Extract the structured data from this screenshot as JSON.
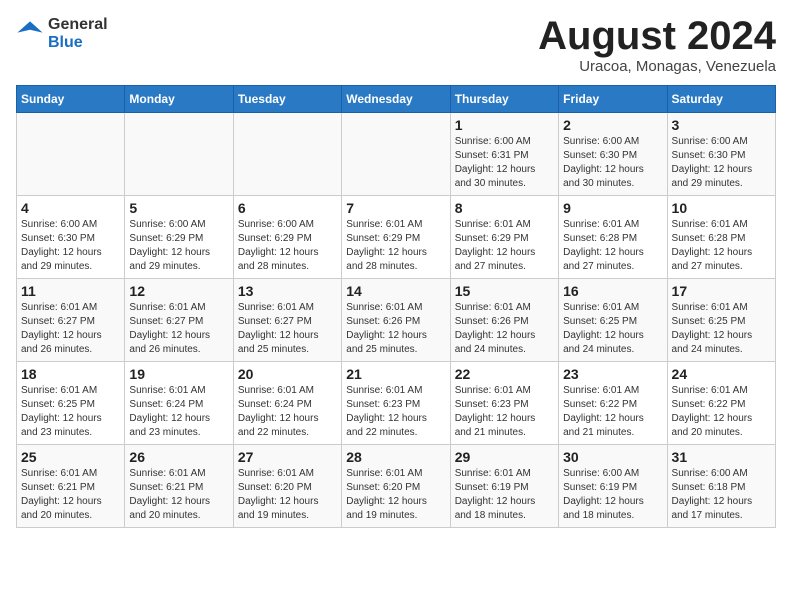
{
  "header": {
    "logo_general": "General",
    "logo_blue": "Blue",
    "month_title": "August 2024",
    "location": "Uracoa, Monagas, Venezuela"
  },
  "days_of_week": [
    "Sunday",
    "Monday",
    "Tuesday",
    "Wednesday",
    "Thursday",
    "Friday",
    "Saturday"
  ],
  "weeks": [
    [
      {
        "day": "",
        "info": ""
      },
      {
        "day": "",
        "info": ""
      },
      {
        "day": "",
        "info": ""
      },
      {
        "day": "",
        "info": ""
      },
      {
        "day": "1",
        "info": "Sunrise: 6:00 AM\nSunset: 6:31 PM\nDaylight: 12 hours\nand 30 minutes."
      },
      {
        "day": "2",
        "info": "Sunrise: 6:00 AM\nSunset: 6:30 PM\nDaylight: 12 hours\nand 30 minutes."
      },
      {
        "day": "3",
        "info": "Sunrise: 6:00 AM\nSunset: 6:30 PM\nDaylight: 12 hours\nand 29 minutes."
      }
    ],
    [
      {
        "day": "4",
        "info": "Sunrise: 6:00 AM\nSunset: 6:30 PM\nDaylight: 12 hours\nand 29 minutes."
      },
      {
        "day": "5",
        "info": "Sunrise: 6:00 AM\nSunset: 6:29 PM\nDaylight: 12 hours\nand 29 minutes."
      },
      {
        "day": "6",
        "info": "Sunrise: 6:00 AM\nSunset: 6:29 PM\nDaylight: 12 hours\nand 28 minutes."
      },
      {
        "day": "7",
        "info": "Sunrise: 6:01 AM\nSunset: 6:29 PM\nDaylight: 12 hours\nand 28 minutes."
      },
      {
        "day": "8",
        "info": "Sunrise: 6:01 AM\nSunset: 6:29 PM\nDaylight: 12 hours\nand 27 minutes."
      },
      {
        "day": "9",
        "info": "Sunrise: 6:01 AM\nSunset: 6:28 PM\nDaylight: 12 hours\nand 27 minutes."
      },
      {
        "day": "10",
        "info": "Sunrise: 6:01 AM\nSunset: 6:28 PM\nDaylight: 12 hours\nand 27 minutes."
      }
    ],
    [
      {
        "day": "11",
        "info": "Sunrise: 6:01 AM\nSunset: 6:27 PM\nDaylight: 12 hours\nand 26 minutes."
      },
      {
        "day": "12",
        "info": "Sunrise: 6:01 AM\nSunset: 6:27 PM\nDaylight: 12 hours\nand 26 minutes."
      },
      {
        "day": "13",
        "info": "Sunrise: 6:01 AM\nSunset: 6:27 PM\nDaylight: 12 hours\nand 25 minutes."
      },
      {
        "day": "14",
        "info": "Sunrise: 6:01 AM\nSunset: 6:26 PM\nDaylight: 12 hours\nand 25 minutes."
      },
      {
        "day": "15",
        "info": "Sunrise: 6:01 AM\nSunset: 6:26 PM\nDaylight: 12 hours\nand 24 minutes."
      },
      {
        "day": "16",
        "info": "Sunrise: 6:01 AM\nSunset: 6:25 PM\nDaylight: 12 hours\nand 24 minutes."
      },
      {
        "day": "17",
        "info": "Sunrise: 6:01 AM\nSunset: 6:25 PM\nDaylight: 12 hours\nand 24 minutes."
      }
    ],
    [
      {
        "day": "18",
        "info": "Sunrise: 6:01 AM\nSunset: 6:25 PM\nDaylight: 12 hours\nand 23 minutes."
      },
      {
        "day": "19",
        "info": "Sunrise: 6:01 AM\nSunset: 6:24 PM\nDaylight: 12 hours\nand 23 minutes."
      },
      {
        "day": "20",
        "info": "Sunrise: 6:01 AM\nSunset: 6:24 PM\nDaylight: 12 hours\nand 22 minutes."
      },
      {
        "day": "21",
        "info": "Sunrise: 6:01 AM\nSunset: 6:23 PM\nDaylight: 12 hours\nand 22 minutes."
      },
      {
        "day": "22",
        "info": "Sunrise: 6:01 AM\nSunset: 6:23 PM\nDaylight: 12 hours\nand 21 minutes."
      },
      {
        "day": "23",
        "info": "Sunrise: 6:01 AM\nSunset: 6:22 PM\nDaylight: 12 hours\nand 21 minutes."
      },
      {
        "day": "24",
        "info": "Sunrise: 6:01 AM\nSunset: 6:22 PM\nDaylight: 12 hours\nand 20 minutes."
      }
    ],
    [
      {
        "day": "25",
        "info": "Sunrise: 6:01 AM\nSunset: 6:21 PM\nDaylight: 12 hours\nand 20 minutes."
      },
      {
        "day": "26",
        "info": "Sunrise: 6:01 AM\nSunset: 6:21 PM\nDaylight: 12 hours\nand 20 minutes."
      },
      {
        "day": "27",
        "info": "Sunrise: 6:01 AM\nSunset: 6:20 PM\nDaylight: 12 hours\nand 19 minutes."
      },
      {
        "day": "28",
        "info": "Sunrise: 6:01 AM\nSunset: 6:20 PM\nDaylight: 12 hours\nand 19 minutes."
      },
      {
        "day": "29",
        "info": "Sunrise: 6:01 AM\nSunset: 6:19 PM\nDaylight: 12 hours\nand 18 minutes."
      },
      {
        "day": "30",
        "info": "Sunrise: 6:00 AM\nSunset: 6:19 PM\nDaylight: 12 hours\nand 18 minutes."
      },
      {
        "day": "31",
        "info": "Sunrise: 6:00 AM\nSunset: 6:18 PM\nDaylight: 12 hours\nand 17 minutes."
      }
    ]
  ]
}
